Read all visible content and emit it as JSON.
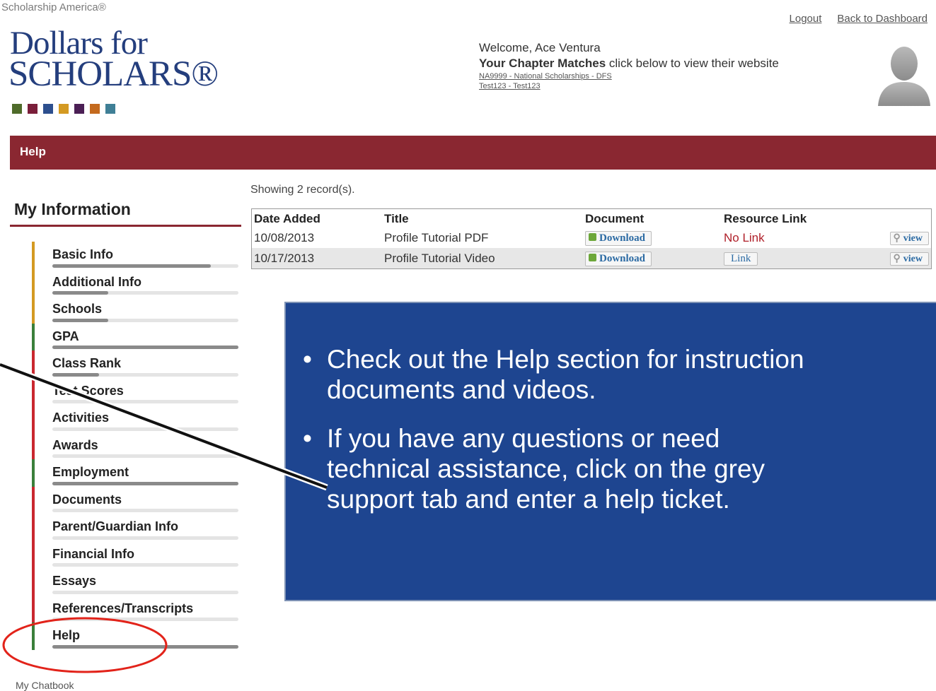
{
  "brand": {
    "org": "Scholarship America®",
    "logo_line1": "Dollars for",
    "logo_line2": "SCHOLARS®",
    "square_colors": [
      "#4f6b2a",
      "#7a1e3a",
      "#2d4f8e",
      "#d49a22",
      "#4b1f55",
      "#c46a1e",
      "#3f7f96"
    ]
  },
  "top_links": {
    "logout": "Logout",
    "back": "Back to Dashboard"
  },
  "welcome": {
    "greeting": "Welcome, Ace Ventura",
    "matches_bold": "Your Chapter Matches",
    "matches_rest": " click below to view their website",
    "chapter_1": "NA9999 - National Scholarships - DFS",
    "chapter_2": "Test123 - Test123"
  },
  "section_bar": {
    "title": "Help"
  },
  "sidebar": {
    "title": "My Information",
    "items": [
      {
        "label": "Basic Info",
        "bar_color": "#d49a22",
        "progress": 0.85
      },
      {
        "label": "Additional Info",
        "bar_color": "#d49a22",
        "progress": 0.3
      },
      {
        "label": "Schools",
        "bar_color": "#d49a22",
        "progress": 0.3
      },
      {
        "label": "GPA",
        "bar_color": "#3a7f3a",
        "progress": 1.0
      },
      {
        "label": "Class Rank",
        "bar_color": "#c9272f",
        "progress": 0.25
      },
      {
        "label": "Test Scores",
        "bar_color": "#c9272f",
        "progress": 0.0
      },
      {
        "label": "Activities",
        "bar_color": "#c9272f",
        "progress": 0.0
      },
      {
        "label": "Awards",
        "bar_color": "#c9272f",
        "progress": 0.0
      },
      {
        "label": "Employment",
        "bar_color": "#3a7f3a",
        "progress": 1.0
      },
      {
        "label": "Documents",
        "bar_color": "#c9272f",
        "progress": 0.0
      },
      {
        "label": "Parent/Guardian Info",
        "bar_color": "#c9272f",
        "progress": 0.0
      },
      {
        "label": "Financial Info",
        "bar_color": "#c9272f",
        "progress": 0.0
      },
      {
        "label": "Essays",
        "bar_color": "#c9272f",
        "progress": 0.0
      },
      {
        "label": "References/Transcripts",
        "bar_color": "#c9272f",
        "progress": 0.0
      },
      {
        "label": "Help",
        "bar_color": "#3a7f3a",
        "progress": 1.0
      }
    ],
    "bottom_label": "My Chatbook"
  },
  "records": {
    "showing": "Showing 2 record(s).",
    "headers": [
      "Date Added",
      "Title",
      "Document",
      "Resource Link",
      ""
    ],
    "rows": [
      {
        "date": "10/08/2013",
        "title": "Profile Tutorial PDF",
        "document": "Download",
        "resource": "No Link",
        "resource_is_link": false,
        "view": "view"
      },
      {
        "date": "10/17/2013",
        "title": "Profile Tutorial Video",
        "document": "Download",
        "resource": "Link",
        "resource_is_link": true,
        "view": "view"
      }
    ]
  },
  "callout": {
    "bullet_1_line_1": "Check out the Help section for instruction",
    "bullet_1_line_2": "documents and videos.",
    "bullet_2_line_1": "If you have any questions or need",
    "bullet_2_line_2": "technical assistance, click on the grey",
    "bullet_2_line_3": "support tab and enter a help ticket."
  }
}
